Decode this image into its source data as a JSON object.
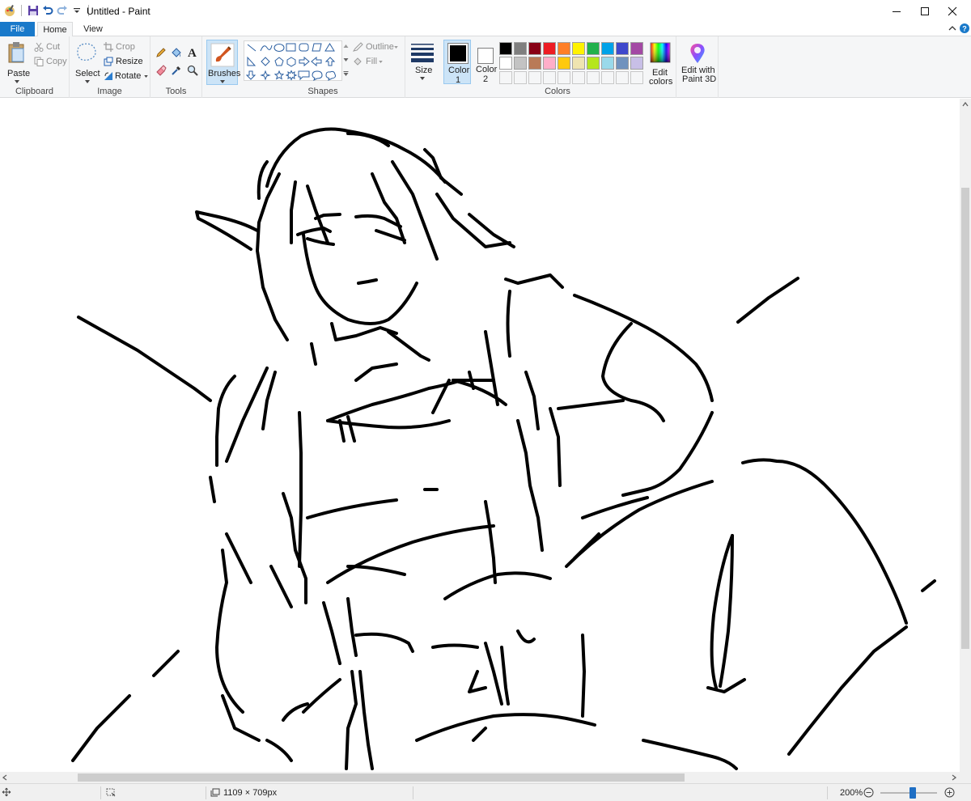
{
  "window": {
    "title": "Untitled - Paint",
    "minimize_glyph": "—",
    "maximize_glyph": "☐",
    "close_glyph": "✕"
  },
  "tabs": {
    "file": "File",
    "home": "Home",
    "view": "View"
  },
  "clipboard": {
    "paste": "Paste",
    "cut": "Cut",
    "copy": "Copy",
    "group": "Clipboard"
  },
  "image": {
    "select": "Select",
    "crop": "Crop",
    "resize": "Resize",
    "rotate": "Rotate",
    "group": "Image"
  },
  "tools": {
    "group": "Tools",
    "text_glyph": "A"
  },
  "brushes": {
    "label": "Brushes"
  },
  "shapes": {
    "outline": "Outline",
    "fill": "Fill",
    "group": "Shapes"
  },
  "size": {
    "label": "Size"
  },
  "colors": {
    "color1": "Color 1",
    "color1_line1": "Color",
    "color1_line2": "1",
    "color2_line1": "Color",
    "color2_line2": "2",
    "color1_value": "#000000",
    "color2_value": "#ffffff",
    "edit_colors_line1": "Edit",
    "edit_colors_line2": "colors",
    "group": "Colors",
    "palette": [
      "#000000",
      "#7f7f7f",
      "#880015",
      "#ed1c24",
      "#ff7f27",
      "#fff200",
      "#22b14c",
      "#00a2e8",
      "#3f48cc",
      "#a349a4",
      "#ffffff",
      "#c3c3c3",
      "#b97a57",
      "#ffaec9",
      "#ffc90e",
      "#efe4b0",
      "#b5e61d",
      "#99d9ea",
      "#7092be",
      "#c8bfe7",
      "#f5f6f7",
      "#f5f6f7",
      "#f5f6f7",
      "#f5f6f7",
      "#f5f6f7",
      "#f5f6f7",
      "#f5f6f7",
      "#f5f6f7",
      "#f5f6f7",
      "#f5f6f7"
    ]
  },
  "paint3d": {
    "line1": "Edit with",
    "line2": "Paint 3D"
  },
  "status": {
    "dimensions": "1109 × 709px",
    "zoom": "200%"
  }
}
